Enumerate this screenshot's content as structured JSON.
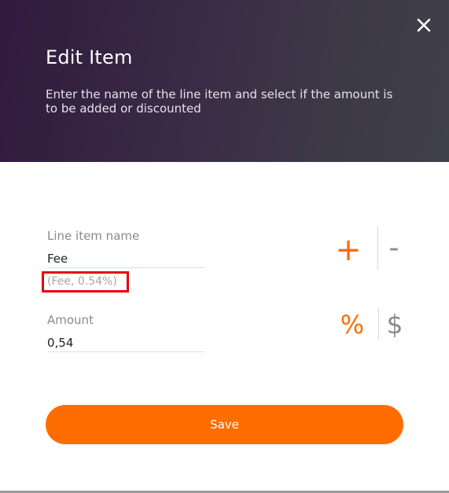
{
  "dialog": {
    "title": "Edit Item",
    "subtitle": "Enter the name of the line item and select if the amount is to be added or discounted",
    "close_icon": "close-icon",
    "fields": {
      "name": {
        "label": "Line item name",
        "value": "Fee",
        "hint": "(Fee, 0.54%)"
      },
      "amount": {
        "label": "Amount",
        "value": "0,54"
      }
    },
    "toggles": {
      "add": {
        "symbol": "+",
        "selected": true
      },
      "discount": {
        "symbol": "-",
        "selected": false
      },
      "percent": {
        "symbol": "%",
        "selected": true
      },
      "dollar": {
        "symbol": "$",
        "selected": false
      }
    },
    "save_label": "Save"
  },
  "colors": {
    "accent": "#ff6d00",
    "inactive": "#8a8a8a",
    "highlight_box": "#e8000c",
    "header_start": "#2f1a3d",
    "header_end": "#404049"
  }
}
